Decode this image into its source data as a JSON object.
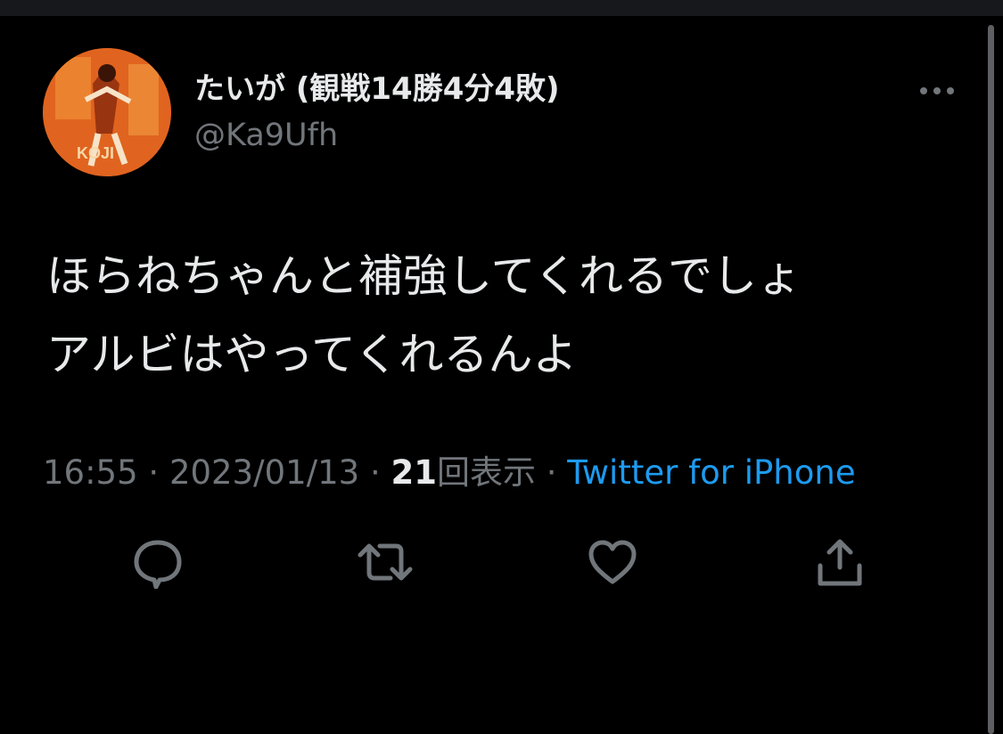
{
  "tweet": {
    "author": {
      "display_name": "たいが (観戦14勝4分4敗)",
      "handle": "@Ka9Ufh",
      "avatar_text": "KOJI"
    },
    "text_lines": [
      "ほらねちゃんと補強してくれるでしょ",
      "アルビはやってくれるんよ"
    ],
    "meta": {
      "time": "16:55",
      "separator": " · ",
      "date": "2023/01/13",
      "views_count": "21",
      "views_label": "回表示",
      "source": "Twitter for iPhone"
    }
  },
  "icons": {
    "more": "more-horizontal-icon",
    "reply": "reply-icon",
    "retweet": "retweet-icon",
    "like": "heart-icon",
    "share": "share-icon"
  },
  "colors": {
    "background": "#000000",
    "primary_text": "#e7e9ea",
    "secondary_text": "#71767b",
    "link": "#1d9bf0"
  }
}
